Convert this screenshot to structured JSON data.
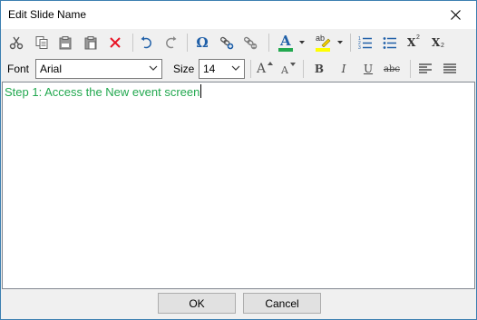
{
  "window": {
    "title": "Edit Slide Name"
  },
  "toolbar": {
    "font_label": "Font",
    "font_value": "Arial",
    "size_label": "Size",
    "size_value": "14",
    "icons": {
      "cut": "scissors-icon",
      "copy": "copy-icon",
      "paste_text": "paste-text-icon",
      "paste": "paste-icon",
      "delete": "delete-icon",
      "undo": "undo-icon",
      "redo": "redo-icon",
      "symbol": "omega-icon",
      "insert_link": "insert-link-icon",
      "remove_link": "remove-link-icon",
      "font_color": "font-color-icon",
      "highlight": "highlight-icon",
      "numbered_list": "numbered-list-icon",
      "bullet_list": "bullet-list-icon",
      "superscript": "superscript-icon",
      "subscript": "subscript-icon",
      "grow_font": "grow-font-icon",
      "shrink_font": "shrink-font-icon",
      "bold": "bold-icon",
      "italic": "italic-icon",
      "underline": "underline-icon",
      "strikethrough": "strikethrough-icon",
      "align_left": "align-left-icon",
      "justify": "justify-icon"
    },
    "glyphs": {
      "omega": "Ω",
      "font_color": "A",
      "highlight": "ab",
      "superscript": "X",
      "superscript_mark": "2",
      "subscript": "X",
      "subscript_mark": "2",
      "grow_font": "A",
      "shrink_font": "A",
      "bold": "B",
      "italic": "I",
      "underline": "U",
      "strikethrough": "abc"
    },
    "colors": {
      "font_color_bar": "#22a84f",
      "highlight_bar": "#ffff00",
      "delete": "#e81123",
      "accent": "#1f5fa8"
    }
  },
  "editor": {
    "text": "Step 1: Access the New event screen",
    "text_color": "#22a84f"
  },
  "footer": {
    "ok_label": "OK",
    "cancel_label": "Cancel"
  }
}
